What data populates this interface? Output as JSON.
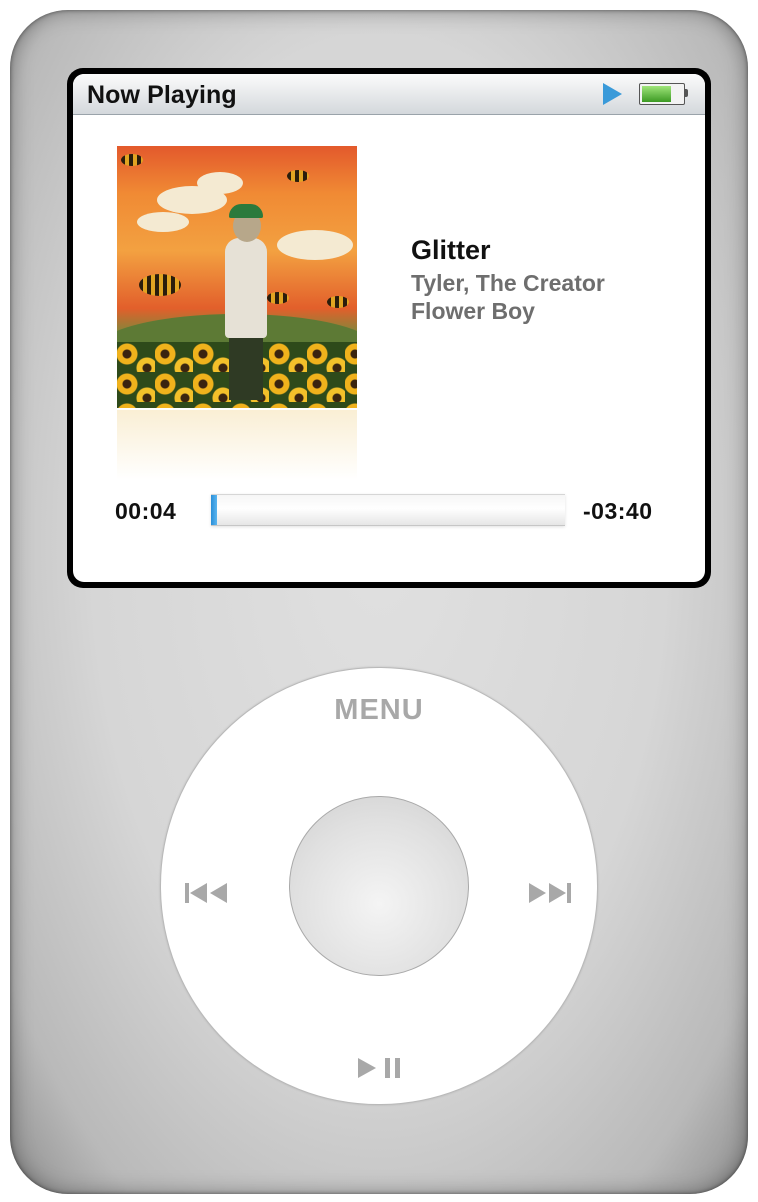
{
  "screen": {
    "title": "Now Playing",
    "status": {
      "play_icon": "play-state-icon",
      "battery_icon": "battery-icon",
      "battery_level": 0.72,
      "accent_color": "#3a9ad9",
      "battery_color": "#3c9a24"
    }
  },
  "now_playing": {
    "song": "Glitter",
    "artist": "Tyler, The Creator",
    "album": "Flower Boy",
    "album_art_icon": "album-artwork",
    "elapsed": "00:04",
    "remaining": "-03:40",
    "progress": 0.018,
    "progress_color": "#2a8fd8"
  },
  "click_wheel": {
    "menu_label": "MENU",
    "prev_icon": "previous-track-icon",
    "next_icon": "next-track-icon",
    "play_pause_icon": "play-pause-icon"
  }
}
